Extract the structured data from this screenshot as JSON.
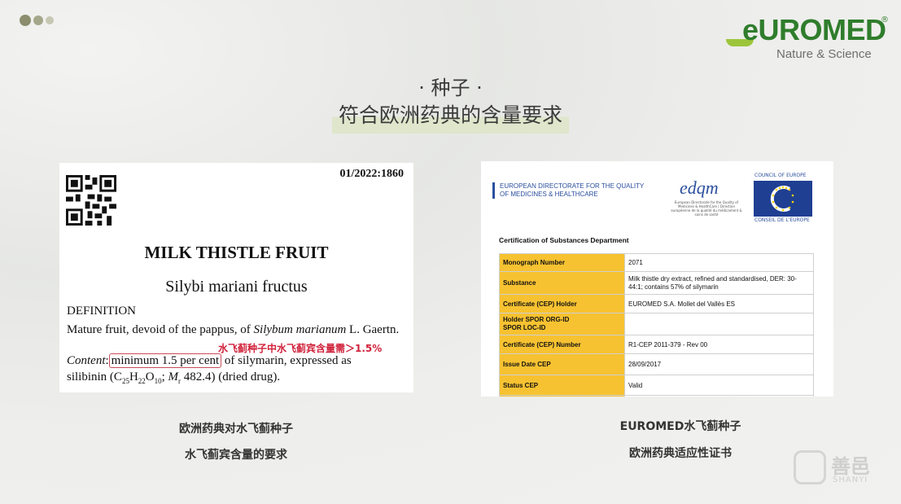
{
  "header": {
    "logo_word": "eUROMED",
    "logo_registered": "®",
    "logo_tagline": "Nature & Science",
    "title_line1": "· 种子 ·",
    "title_line2": "符合欧洲药典的含量要求"
  },
  "monograph": {
    "doc_number": "01/2022:1860",
    "title": "MILK THISTLE FRUIT",
    "latin_name": "Silybi mariani fructus",
    "definition_heading": "DEFINITION",
    "definition_text_1": "Mature fruit, devoid of the pappus, of ",
    "definition_species": "Silybum marianum",
    "definition_text_2": " L. Gaertn.",
    "content_label": "Content",
    "content_highlight": "minimum 1.5 per cent",
    "content_rest": " of silymarin, expressed as",
    "formula_prefix": "silibinin (C",
    "formula_sub1": "25",
    "formula_h": "H",
    "formula_sub2": "22",
    "formula_o": "O",
    "formula_sub3": "10",
    "formula_sep": "; ",
    "formula_mr": "M",
    "formula_mr_sub": "r",
    "formula_suffix": " 482.4) (dried drug).",
    "annotation": "水飞蓟种子中水飞蓟宾含量需＞1.5%"
  },
  "certificate": {
    "edqm_header_line1": "EUROPEAN DIRECTORATE FOR THE QUALITY",
    "edqm_header_line2": "OF MEDICINES & HEALTHCARE",
    "edqm_logo": "edqm",
    "edqm_small_text": "European Directorate for the Quality of Medicines & HealthCare | Direction européenne de la qualité du médicament & soins de santé",
    "coe_top": "COUNCIL OF EUROPE",
    "coe_bottom": "CONSEIL DE L'EUROPE",
    "department": "Certification of Substances Department",
    "rows": [
      {
        "key": "Monograph Number",
        "value": "2071"
      },
      {
        "key": "Substance",
        "value": "Milk thistle dry extract, refined and standardised, DER: 30-44:1; contains 57% of silymarin"
      },
      {
        "key": "Certificate (CEP) Holder",
        "value": "EUROMED S.A. Mollet del Vallès ES"
      },
      {
        "key": "Holder SPOR ORG-ID",
        "key2": "SPOR LOC-ID",
        "value": ""
      },
      {
        "key": "Certificate (CEP) Number",
        "value": "R1-CEP 2011-379 - Rev 00"
      },
      {
        "key": "Issue Date CEP",
        "value": "28/09/2017"
      },
      {
        "key": "Status CEP",
        "value": "Valid"
      }
    ]
  },
  "captions": {
    "left_line1": "欧洲药典对水飞蓟种子",
    "left_line2": "水飞蓟宾含量的要求",
    "right_line1": "EUROMED水飞蓟种子",
    "right_line2": "欧洲药典适应性证书"
  },
  "watermark": {
    "cn": "善邑",
    "en": "SHANYI"
  },
  "colors": {
    "brand_green": "#2f7d2c",
    "leaf_green": "#9cc53b",
    "highlight_red": "#d0213a",
    "table_key_yellow": "#f7c231",
    "edqm_blue": "#2b4f9e"
  }
}
